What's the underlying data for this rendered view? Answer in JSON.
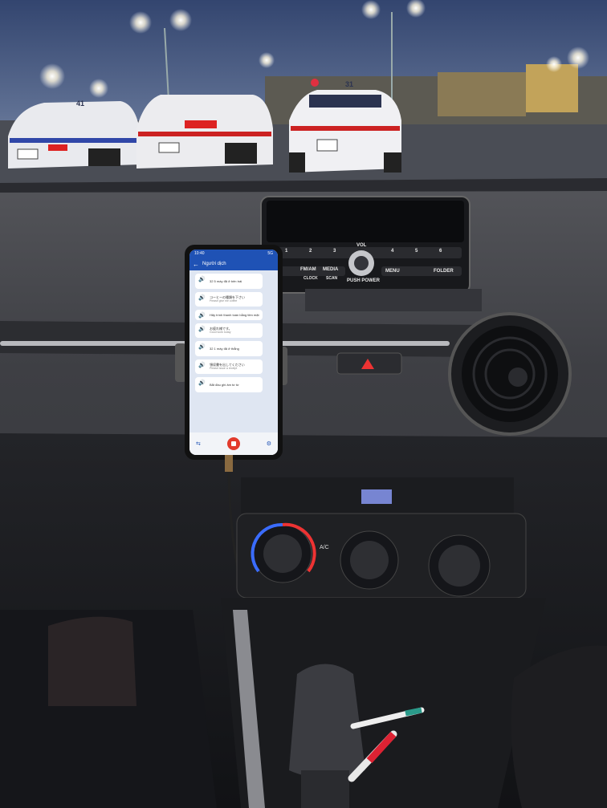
{
  "radio": {
    "vol_label": "VOL",
    "push_power_label": "PUSH POWER",
    "fm_am_label": "FM/AM",
    "media_label": "MEDIA",
    "clock_label": "CLOCK",
    "scan_label": "SCAN",
    "menu_label": "MENU",
    "folder_label": "FOLDER",
    "presets": [
      "1",
      "2",
      "3",
      "4",
      "5",
      "6"
    ]
  },
  "taxi_roof_numbers": [
    "41",
    "31"
  ],
  "hvac_ac_label": "A/C",
  "phone": {
    "status_time": "10:40",
    "status_right": "5G",
    "app_title": "Người dịch",
    "messages": [
      {
        "primary": "32 5 máy đã ở bên trái",
        "secondary": ""
      },
      {
        "primary": "コーヒーの種類を下さい",
        "secondary": "Please give me coffee"
      },
      {
        "primary": "Hãy trình thanh toán bằng tiền mặt",
        "secondary": ""
      },
      {
        "primary": "お疲れ様です。",
        "secondary": "Good work today"
      },
      {
        "primary": "32 1 máy đã ở thẳng",
        "secondary": ""
      },
      {
        "primary": "領収書を出してください",
        "secondary": "Please issue a receipt"
      },
      {
        "primary": "Bắt đầu ghi âm từ từ",
        "secondary": ""
      }
    ]
  },
  "colors": {
    "sky_top": "#3a4b78",
    "sky_bottom": "#7c8aa8",
    "dash": "#3d3e43",
    "phone_accent": "#1f52b5",
    "record_red": "#e23a2c"
  }
}
